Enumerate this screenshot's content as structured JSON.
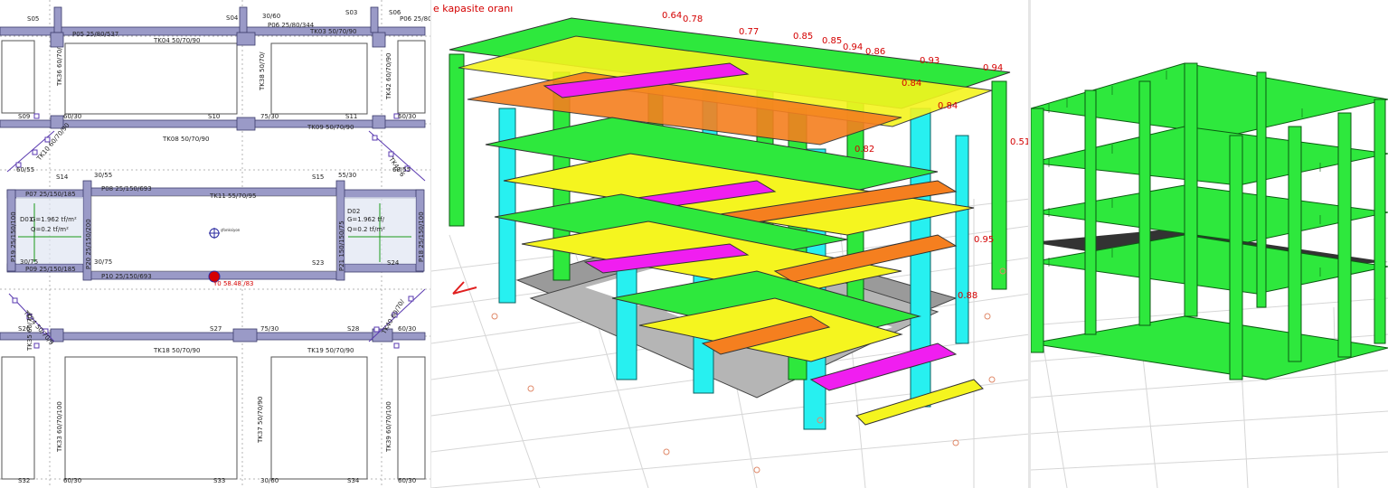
{
  "colors": {
    "beam": "#9a9ac7",
    "beam_stroke": "#3b3b6b",
    "ratio_text": "#d40000",
    "green": "#2ee83d",
    "yellow": "#f5f51f",
    "cyan": "#27f0f0",
    "magenta": "#f01ef0",
    "orange": "#f57f1f",
    "foundation": "#9a9a9a",
    "grid": "#cfcfcf"
  },
  "plan": {
    "top_labels": [
      "S05",
      "P05 25/80/537",
      "S04",
      "30/60",
      "P06 25/80/344",
      "S03",
      "S06",
      "P06 25/80/"
    ],
    "tk04": "TK04 50/70/90",
    "tk03": "TK03 50/70/90",
    "tk36": "TK36 60/70/",
    "tk38": "TK38 50/70/",
    "tk42": "TK42 60/70/90",
    "row2": [
      "S09",
      "60/30",
      "S10",
      "75/30",
      "S11",
      "60/30"
    ],
    "tk08": "TK08 50/70/90",
    "tk09": "TK09 50/70/90",
    "tk10": "TK10 60/70/90",
    "tk11": "TK11 55/70/95",
    "tk33": "TK33 60/70/",
    "tk41": "TK41 6",
    "s14": "S14",
    "s15": "S15",
    "c60_55a": "60/55",
    "c60_55b": "60/55",
    "c30_75a": "30/75",
    "c30_75b": "30/75",
    "c30_55": "30/55",
    "c55_30": "55/30",
    "p07": "P07 25/150/185",
    "p08": "P08 25/150/693",
    "p09": "P09 25/150/185",
    "p10": "P10 25/150/693",
    "p19": "P19 25/150/100",
    "p20": "P20 25/150/200",
    "p21": "P21 150/150/75",
    "p18": "P18 25/150/100",
    "load_g_left": "G=1.962 tf/m²",
    "load_q_left": "Q=0.2 tf/m²",
    "load_g_right": "G=1.962 tf/",
    "load_q_right": "Q=0.2 tf/m²",
    "slab_left": "D01",
    "slab_right": "D02",
    "center_label": "şfonksiyon",
    "marker_label": "Y0 58.48 /83",
    "s23": "S23",
    "s24": "S24",
    "row_bottom": [
      "S26",
      "S27",
      "75/30",
      "S28",
      "60/30"
    ],
    "tk18": "TK18 50/70/90",
    "tk19": "TK19 50/70/90",
    "tk24": "TK24 50/70/9",
    "tk35": "TK35 60/70/",
    "tk40": "TK40 60/70/",
    "tk33b": "TK33 60/70/100",
    "tk37": "TK37 50/70/90",
    "tk39": "TK39 60/70/100",
    "bottom_labels": [
      "S32",
      "60/30",
      "S33",
      "30/60",
      "S34",
      "60/30"
    ]
  },
  "model3d": {
    "title": "e kapasite oranı",
    "ratios": [
      "0.64",
      "0.78",
      "0.77",
      "0.85",
      "0.85",
      "0.94",
      "0.86",
      "0.93",
      "0.94",
      "0.84",
      "0.84",
      "0.82",
      "0.51",
      "0.95",
      "0.88"
    ]
  }
}
